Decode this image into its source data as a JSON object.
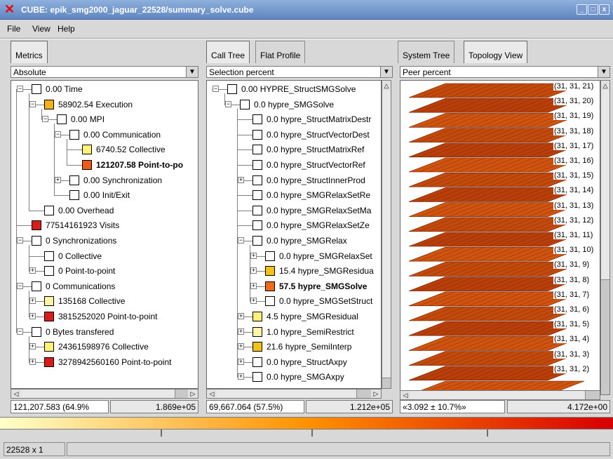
{
  "window": {
    "title": "CUBE: epik_smg2000_jaguar_22528/summary_solve.cube",
    "controls": [
      "_",
      "□",
      "x"
    ]
  },
  "menu": [
    "File",
    "View",
    "Help"
  ],
  "metric_pane": {
    "tabs": [
      "Metrics"
    ],
    "combo": "Absolute",
    "rows": [
      {
        "level": 0,
        "exp": "-",
        "color": "#ffffff",
        "label": "0.00 Time",
        "bold": false
      },
      {
        "level": 1,
        "exp": "-",
        "color": "#f2b21c",
        "label": "58902.54 Execution",
        "bold": false
      },
      {
        "level": 2,
        "exp": "-",
        "color": "#ffffff",
        "label": "0.00 MPI",
        "bold": false
      },
      {
        "level": 3,
        "exp": "-",
        "color": "#ffffff",
        "label": "0.00 Communication",
        "bold": false
      },
      {
        "level": 4,
        "exp": "",
        "color": "#fff07a",
        "label": "6740.52 Collective",
        "bold": false
      },
      {
        "level": 4,
        "exp": "",
        "color": "#ef5a19",
        "label": "121207.58 Point-to-po",
        "bold": true
      },
      {
        "level": 3,
        "exp": "+",
        "color": "#ffffff",
        "label": "0.00 Synchronization",
        "bold": false
      },
      {
        "level": 3,
        "exp": "",
        "color": "#ffffff",
        "label": "0.00 Init/Exit",
        "bold": false
      },
      {
        "level": 1,
        "exp": "",
        "color": "#ffffff",
        "label": "0.00 Overhead",
        "bold": false
      },
      {
        "level": 0,
        "exp": "",
        "color": "#d81c1c",
        "label": "77514161923 Visits",
        "bold": false
      },
      {
        "level": 0,
        "exp": "-",
        "color": "#ffffff",
        "label": "0 Synchronizations",
        "bold": false
      },
      {
        "level": 1,
        "exp": "",
        "color": "#ffffff",
        "label": "0 Collective",
        "bold": false
      },
      {
        "level": 1,
        "exp": "+",
        "color": "#ffffff",
        "label": "0 Point-to-point",
        "bold": false
      },
      {
        "level": 0,
        "exp": "-",
        "color": "#ffffff",
        "label": "0 Communications",
        "bold": false
      },
      {
        "level": 1,
        "exp": "+",
        "color": "#fff4a8",
        "label": "135168 Collective",
        "bold": false
      },
      {
        "level": 1,
        "exp": "+",
        "color": "#d81c1c",
        "label": "3815252020 Point-to-point",
        "bold": false
      },
      {
        "level": 0,
        "exp": "-",
        "color": "#ffffff",
        "label": "0 Bytes transfered",
        "bold": false
      },
      {
        "level": 1,
        "exp": "+",
        "color": "#fff07a",
        "label": "24361598976 Collective",
        "bold": false
      },
      {
        "level": 1,
        "exp": "+",
        "color": "#d81c1c",
        "label": "3278942560160 Point-to-point",
        "bold": false
      }
    ],
    "value": "121,207.583 (64.9%",
    "max": "1.869e+05"
  },
  "call_pane": {
    "tabs": [
      "Call Tree",
      "Flat Profile"
    ],
    "combo": "Selection percent",
    "rows": [
      {
        "level": 0,
        "exp": "-",
        "color": "#ffffff",
        "label": "0.00 HYPRE_StructSMGSolve",
        "bold": false
      },
      {
        "level": 1,
        "exp": "-",
        "color": "#ffffff",
        "label": "0.0 hypre_SMGSolve",
        "bold": false
      },
      {
        "level": 2,
        "exp": "",
        "color": "#ffffff",
        "label": "0.0 hypre_StructMatrixDestr",
        "bold": false
      },
      {
        "level": 2,
        "exp": "",
        "color": "#ffffff",
        "label": "0.0 hypre_StructVectorDest",
        "bold": false
      },
      {
        "level": 2,
        "exp": "",
        "color": "#ffffff",
        "label": "0.0 hypre_StructMatrixRef",
        "bold": false
      },
      {
        "level": 2,
        "exp": "",
        "color": "#ffffff",
        "label": "0.0 hypre_StructVectorRef",
        "bold": false
      },
      {
        "level": 2,
        "exp": "+",
        "color": "#ffffff",
        "label": "0.0 hypre_StructInnerProd",
        "bold": false
      },
      {
        "level": 2,
        "exp": "",
        "color": "#ffffff",
        "label": "0.0 hypre_SMGRelaxSetRe",
        "bold": false
      },
      {
        "level": 2,
        "exp": "",
        "color": "#ffffff",
        "label": "0.0 hypre_SMGRelaxSetMa",
        "bold": false
      },
      {
        "level": 2,
        "exp": "",
        "color": "#ffffff",
        "label": "0.0 hypre_SMGRelaxSetZe",
        "bold": false
      },
      {
        "level": 2,
        "exp": "-",
        "color": "#ffffff",
        "label": "0.0 hypre_SMGRelax",
        "bold": false
      },
      {
        "level": 3,
        "exp": "+",
        "color": "#ffffff",
        "label": "0.0 hypre_SMGRelaxSet",
        "bold": false
      },
      {
        "level": 3,
        "exp": "+",
        "color": "#f2c21c",
        "label": "15.4 hypre_SMGResidua",
        "bold": false
      },
      {
        "level": 3,
        "exp": "+",
        "color": "#ef6a19",
        "label": "57.5 hypre_SMGSolve",
        "bold": true
      },
      {
        "level": 3,
        "exp": "+",
        "color": "#ffffff",
        "label": "0.0 hypre_SMGSetStruct",
        "bold": false
      },
      {
        "level": 2,
        "exp": "+",
        "color": "#fff07a",
        "label": "4.5 hypre_SMGResidual",
        "bold": false
      },
      {
        "level": 2,
        "exp": "+",
        "color": "#fff4a8",
        "label": "1.0 hypre_SemiRestrict",
        "bold": false
      },
      {
        "level": 2,
        "exp": "+",
        "color": "#f2c21c",
        "label": "21.6 hypre_SemiInterp",
        "bold": false
      },
      {
        "level": 2,
        "exp": "+",
        "color": "#ffffff",
        "label": "0.0 hypre_StructAxpy",
        "bold": false
      },
      {
        "level": 2,
        "exp": "+",
        "color": "#ffffff",
        "label": "0.0 hypre_SMGAxpy",
        "bold": false
      }
    ],
    "value": "69,667.064  (57.5%)",
    "max": "1.212e+05"
  },
  "system_pane": {
    "tabs": [
      "System Tree",
      "Topology View"
    ],
    "combo": "Peer percent",
    "plane_labels": [
      "(31, 31, 21)",
      "(31, 31, 20)",
      "(31, 31, 19)",
      "(31, 31, 18)",
      "(31, 31, 17)",
      "(31, 31, 16)",
      "(31, 31, 15)",
      "(31, 31, 14)",
      "(31, 31, 13)",
      "(31, 31, 12)",
      "(31, 31, 11)",
      "(31, 31, 10)",
      "(31, 31, 9)",
      "(31, 31, 8)",
      "(31, 31, 7)",
      "(31, 31, 6)",
      "(31, 31, 5)",
      "(31, 31, 4)",
      "(31, 31, 3)",
      "(31, 31, 2)"
    ],
    "value": "«3.092 ± 10.7%»",
    "max": "4.172e+00"
  },
  "status": "22528 x 1",
  "colors": {
    "selection_green": "#00a000",
    "titlebar": "#6f93c9"
  }
}
